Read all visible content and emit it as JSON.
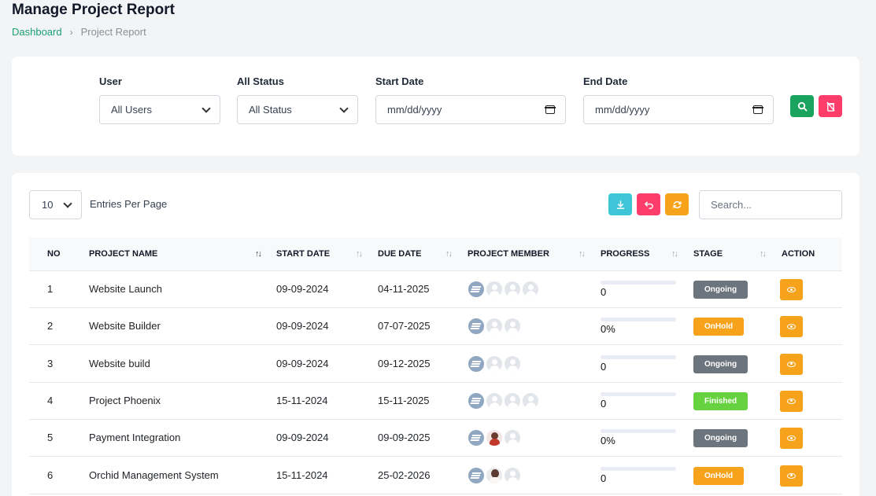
{
  "page": {
    "title": "Manage Project Report",
    "breadcrumb": {
      "home": "Dashboard",
      "current": "Project Report"
    }
  },
  "filters": {
    "user": {
      "label": "User",
      "value": "All Users"
    },
    "status": {
      "label": "All Status",
      "value": "All Status"
    },
    "start_date": {
      "label": "Start Date",
      "value": "mm/dd/yyyy"
    },
    "end_date": {
      "label": "End Date",
      "value": "mm/dd/yyyy"
    },
    "search_button_color": "#1aa35d",
    "clear_button_color": "#ff3d6b"
  },
  "table_controls": {
    "entries_value": "10",
    "entries_label": "Entries Per Page",
    "search_placeholder": "Search...",
    "export_button_color": "#3ec5d7",
    "back_button_color": "#ff3d6b",
    "refresh_button_color": "#f7a21b"
  },
  "table": {
    "headers": {
      "no": "NO",
      "project_name": "PROJECT NAME",
      "start_date": "START DATE",
      "due_date": "DUE DATE",
      "project_member": "PROJECT MEMBER",
      "progress": "PROGRESS",
      "stage": "STAGE",
      "action": "ACTION"
    },
    "rows": [
      {
        "no": "1",
        "name": "Website Launch",
        "start": "09-09-2024",
        "due": "04-11-2025",
        "members": [
          "logo",
          "placeholder",
          "placeholder",
          "placeholder"
        ],
        "progress": 0,
        "progress_text": "0",
        "stage": "Ongoing",
        "stage_color": "#6c757d"
      },
      {
        "no": "2",
        "name": "Website Builder",
        "start": "09-09-2024",
        "due": "07-07-2025",
        "members": [
          "logo",
          "placeholder",
          "placeholder"
        ],
        "progress": 0,
        "progress_text": "0%",
        "stage": "OnHold",
        "stage_color": "#f7a21b"
      },
      {
        "no": "3",
        "name": "Website build",
        "start": "09-09-2024",
        "due": "09-12-2025",
        "members": [
          "logo",
          "placeholder",
          "placeholder"
        ],
        "progress": 0,
        "progress_text": "0",
        "stage": "Ongoing",
        "stage_color": "#6c757d"
      },
      {
        "no": "4",
        "name": "Project Phoenix",
        "start": "15-11-2024",
        "due": "15-11-2025",
        "members": [
          "logo",
          "placeholder",
          "placeholder",
          "placeholder"
        ],
        "progress": 0,
        "progress_text": "0",
        "stage": "Finished",
        "stage_color": "#67d23f"
      },
      {
        "no": "5",
        "name": "Payment Integration",
        "start": "09-09-2024",
        "due": "09-09-2025",
        "members": [
          "logo",
          "photo-red",
          "placeholder"
        ],
        "progress": 0,
        "progress_text": "0%",
        "stage": "Ongoing",
        "stage_color": "#6c757d"
      },
      {
        "no": "6",
        "name": "Orchid Management System",
        "start": "15-11-2024",
        "due": "25-02-2026",
        "members": [
          "logo",
          "photo-white",
          "placeholder"
        ],
        "progress": 0,
        "progress_text": "0",
        "stage": "OnHold",
        "stage_color": "#f7a21b"
      }
    ]
  }
}
